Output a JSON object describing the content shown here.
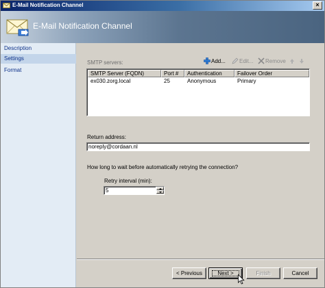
{
  "window": {
    "title": "E-Mail Notification Channel",
    "close_glyph": "×"
  },
  "header": {
    "title": "E-Mail Notification Channel"
  },
  "sidebar": {
    "items": [
      {
        "label": "Description",
        "active": false
      },
      {
        "label": "Settings",
        "active": true
      },
      {
        "label": "Format",
        "active": false
      }
    ]
  },
  "smtp": {
    "label": "SMTP servers:",
    "toolbar": {
      "add_label": "Add...",
      "edit_label": "Edit...",
      "remove_label": "Remove"
    },
    "columns": [
      "SMTP Server (FQDN)",
      "Port #",
      "Authentication",
      "Failover Order"
    ],
    "rows": [
      {
        "server": "ex030.zorg.local",
        "port": "25",
        "auth": "Anonymous",
        "order": "Primary"
      }
    ]
  },
  "return_address": {
    "label": "Return address:",
    "value": "noreply@cordaan.nl"
  },
  "retry": {
    "question": "How long to wait before automatically retrying the connection?",
    "interval_label": "Retry interval (min):",
    "interval_value": "5"
  },
  "buttons": {
    "previous": "< Previous",
    "next": "Next >",
    "finish": "Finish",
    "cancel": "Cancel"
  },
  "colors": {
    "accent_blue": "#0a246a",
    "sidebar_bg": "#e3ecf5",
    "dialog_bg": "#d4d0c8"
  }
}
